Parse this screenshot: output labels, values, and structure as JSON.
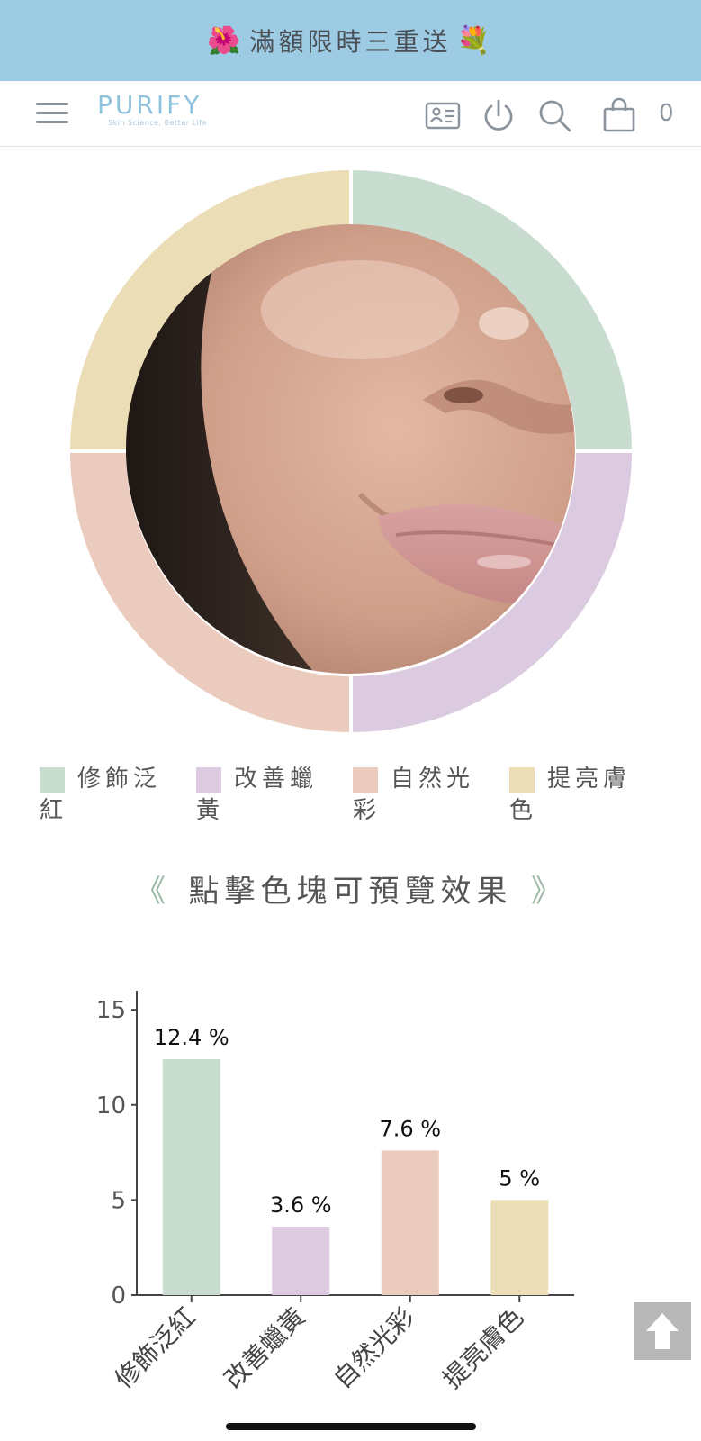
{
  "promo": {
    "text": "滿額限時三重送",
    "icon_left": "hibiscus-icon",
    "icon_right": "bouquet-icon"
  },
  "header": {
    "logo_text": "PURIFY",
    "logo_tagline": "Skin Science, Better Life",
    "cart_count": "0",
    "icons": [
      "menu-icon",
      "member-card-icon",
      "power-icon",
      "search-icon",
      "shopping-bag-icon"
    ]
  },
  "legend": [
    {
      "line1": "修飾泛",
      "line2": "紅",
      "color": "#c8dccf"
    },
    {
      "line1": "改善蠟",
      "line2": "黃",
      "color": "#dccbe0"
    },
    {
      "line1": "自然光",
      "line2": "彩",
      "color": "#ebcbbd"
    },
    {
      "line1": "提亮膚",
      "line2": "色",
      "color": "#ebddb6"
    }
  ],
  "hint": {
    "text": "點擊色塊可預覽效果",
    "prev": "《",
    "next": "》"
  },
  "chart_data": {
    "type": "bar",
    "categories": [
      "修飾泛紅",
      "改善蠟黃",
      "自然光彩",
      "提亮膚色"
    ],
    "values": [
      12.4,
      3.6,
      7.6,
      5
    ],
    "value_labels": [
      "12.4 %",
      "3.6 %",
      "7.6 %",
      "5 %"
    ],
    "colors": [
      "#c8dccf",
      "#dccbe0",
      "#ebcbbd",
      "#ebddb6"
    ],
    "ylim": [
      0,
      16
    ],
    "yticks": [
      0,
      5,
      10,
      15
    ],
    "grid": false,
    "legend": "none"
  }
}
